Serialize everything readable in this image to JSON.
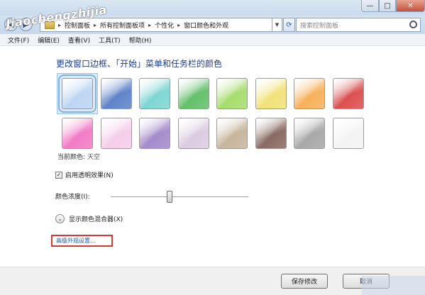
{
  "window": {
    "minimize_glyph": "—",
    "maximize_glyph": "□",
    "close_glyph": "✕"
  },
  "watermark": "Jiaochengzhijia",
  "address": {
    "crumbs": [
      "控制面板",
      "所有控制面板项",
      "个性化",
      "窗口颜色和外观"
    ],
    "search_placeholder": "搜索控制面板"
  },
  "menu": [
    "文件(F)",
    "编辑(E)",
    "查看(V)",
    "工具(T)",
    "帮助(H)"
  ],
  "heading": "更改窗口边框、「开始」菜单和任务栏的颜色",
  "swatches": [
    {
      "name": "sky",
      "color": "#bcd6f3"
    },
    {
      "name": "twilight",
      "color": "#5d83c8"
    },
    {
      "name": "sea",
      "color": "#7dd6d4"
    },
    {
      "name": "leaf",
      "color": "#63c06a"
    },
    {
      "name": "lime",
      "color": "#a7dd6e"
    },
    {
      "name": "sun",
      "color": "#f2e27a"
    },
    {
      "name": "pumpkin",
      "color": "#f7b15a"
    },
    {
      "name": "ruby",
      "color": "#dc4f4f"
    },
    {
      "name": "fuchsia",
      "color": "#f27ac5"
    },
    {
      "name": "blush",
      "color": "#f6cdea"
    },
    {
      "name": "violet",
      "color": "#a48bcb"
    },
    {
      "name": "lavender",
      "color": "#dccbe2"
    },
    {
      "name": "taupe",
      "color": "#c7b59c"
    },
    {
      "name": "chocolate",
      "color": "#8a6a63"
    },
    {
      "name": "slate",
      "color": "#a8a8a8"
    },
    {
      "name": "frost",
      "color": "#f3f3f3"
    }
  ],
  "current_color": {
    "label": "当前颜色:",
    "value": "天空"
  },
  "transparency": {
    "label": "启用透明效果(N)",
    "checked": true
  },
  "intensity": {
    "label": "颜色浓度(I):",
    "level": 0.43
  },
  "mixer_label": "显示颜色混合器(X)",
  "advanced_link": "高级外观设置...",
  "buttons": {
    "save": "保存修改",
    "cancel": "取消"
  }
}
